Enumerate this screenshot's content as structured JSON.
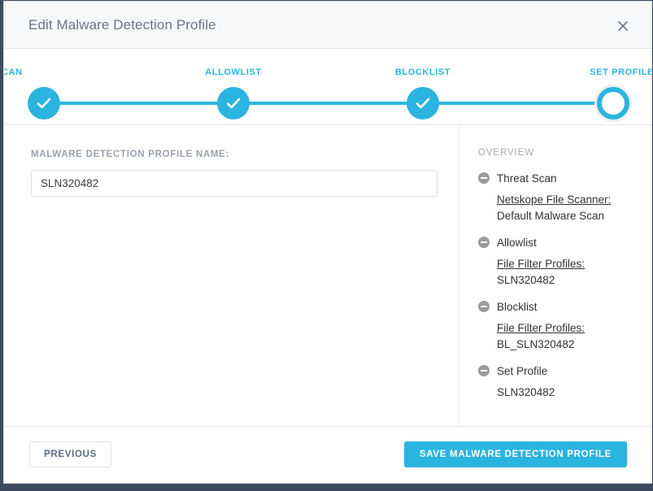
{
  "modal": {
    "title": "Edit Malware Detection Profile",
    "close_icon": "close-icon"
  },
  "stepper": {
    "steps": [
      {
        "label": "THREAT SCAN",
        "state": "complete"
      },
      {
        "label": "ALLOWLIST",
        "state": "complete"
      },
      {
        "label": "BLOCKLIST",
        "state": "complete"
      },
      {
        "label": "SET PROFILE",
        "state": "active"
      }
    ],
    "accent_color": "#2bb4e0"
  },
  "form": {
    "name_label": "MALWARE DETECTION PROFILE NAME:",
    "name_value": "SLN320482",
    "name_placeholder": ""
  },
  "overview": {
    "title": "OVERVIEW",
    "groups": [
      {
        "name": "Threat Scan",
        "icon": "minus-circle-icon",
        "detail_key": "Netskope File Scanner:",
        "detail_value": "Default Malware Scan"
      },
      {
        "name": "Allowlist",
        "icon": "minus-circle-icon",
        "detail_key": "File Filter Profiles:",
        "detail_value": "SLN320482"
      },
      {
        "name": "Blocklist",
        "icon": "minus-circle-icon",
        "detail_key": "File Filter Profiles:",
        "detail_value": "BL_SLN320482"
      },
      {
        "name": "Set Profile",
        "icon": "minus-circle-icon",
        "detail_key": "",
        "detail_value": "SLN320482"
      }
    ]
  },
  "footer": {
    "previous_label": "PREVIOUS",
    "save_label": "SAVE MALWARE DETECTION PROFILE"
  }
}
